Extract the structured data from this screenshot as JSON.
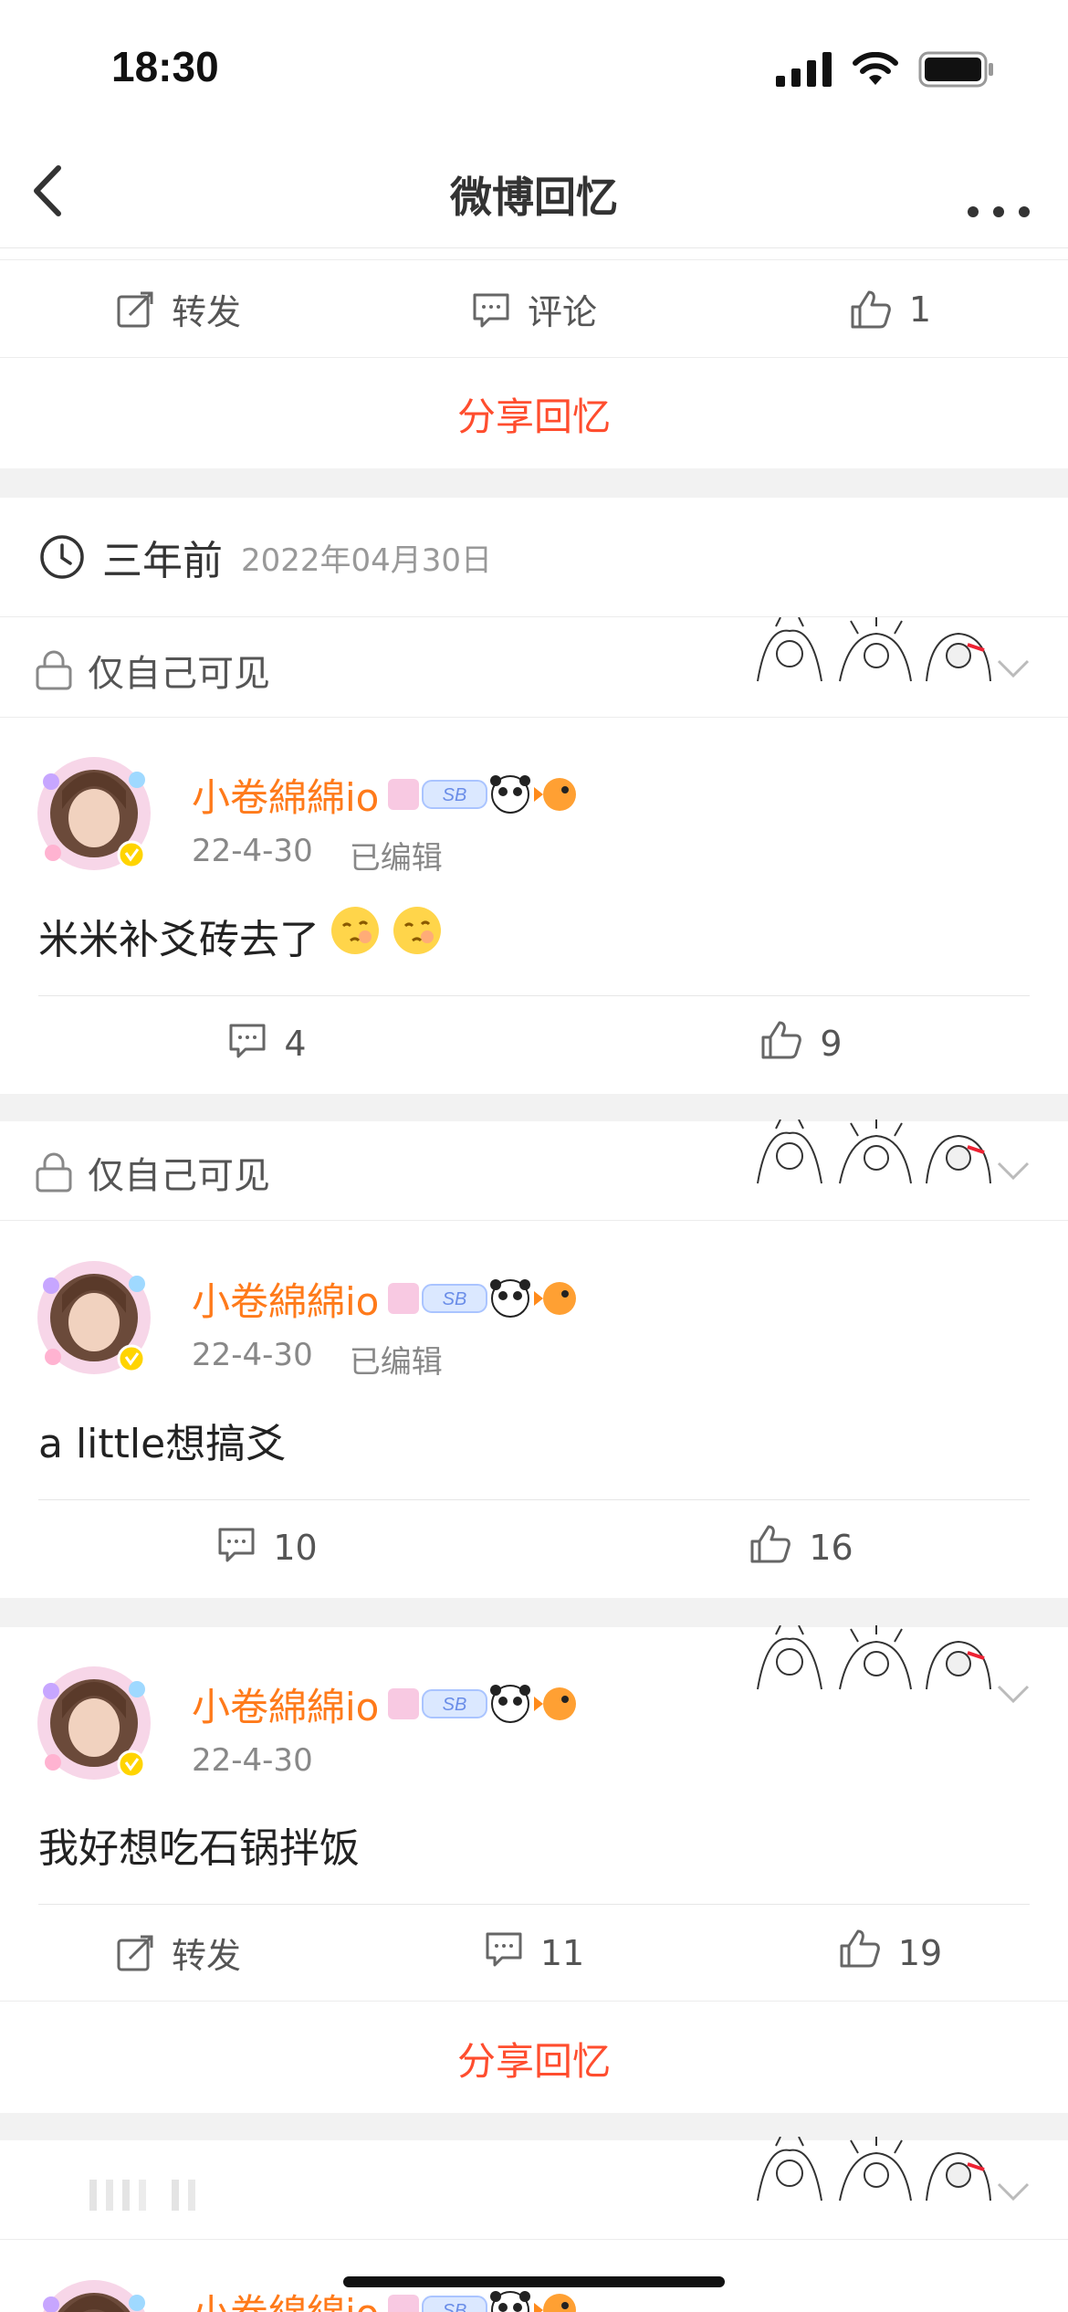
{
  "status_bar": {
    "time": "18:30"
  },
  "nav": {
    "title": "微博回忆"
  },
  "top_actions": {
    "repost": "转发",
    "comment": "评论",
    "like": "1"
  },
  "share_label": "分享回忆",
  "date_header": {
    "relative": "三年前",
    "date": "2022年04月30日"
  },
  "visibility_label": "仅自己可见",
  "user": {
    "name": "小卷綿綿io",
    "badge_text": "SB"
  },
  "posts": [
    {
      "date": "22-4-30",
      "edited": "已编辑",
      "text": "米米补爻砖去了",
      "comments": "4",
      "likes": "9"
    },
    {
      "date": "22-4-30",
      "edited": "已编辑",
      "text": "a little想搞爻",
      "comments": "10",
      "likes": "16"
    },
    {
      "date": "22-4-30",
      "text": "我好想吃石锅拌饭",
      "repost": "转发",
      "comments": "11",
      "likes": "19"
    }
  ],
  "partial_user_name": "小卷綿綿io",
  "colors": {
    "accent_orange": "#ff7a1a",
    "share_red": "#ff4d2e",
    "separator": "#f2f2f2"
  }
}
